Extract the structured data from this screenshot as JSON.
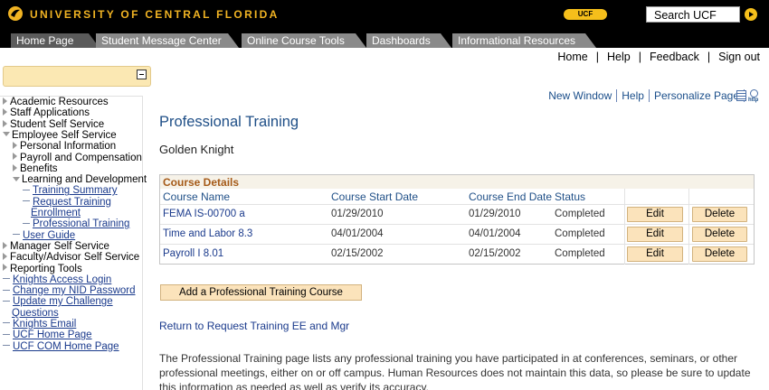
{
  "header": {
    "university_name": "UNIVERSITY OF CENTRAL FLORIDA",
    "badge": "UCF",
    "search_value": "Search UCF",
    "logo_icon": "pegasus-logo-icon",
    "search_go_icon": "go-arrow-icon",
    "brand_color": "#f0b323"
  },
  "nav": {
    "tabs": [
      {
        "label": "Home Page",
        "active": true
      },
      {
        "label": "Student Message Center",
        "active": false
      },
      {
        "label": "Online Course Tools",
        "active": false
      },
      {
        "label": "Dashboards",
        "active": false
      },
      {
        "label": "Informational Resources",
        "active": false
      }
    ]
  },
  "utility_links": [
    "Home",
    "Help",
    "Feedback",
    "Sign out"
  ],
  "page_links": {
    "new_window": "New Window",
    "help": "Help",
    "personalize": "Personalize Page",
    "http_icon_text": "http"
  },
  "sidebar": {
    "items": [
      {
        "label": "Academic Resources",
        "kind": "collapsed"
      },
      {
        "label": "Staff Applications",
        "kind": "collapsed"
      },
      {
        "label": "Student Self Service",
        "kind": "collapsed"
      },
      {
        "label": "Employee Self Service",
        "kind": "expanded"
      },
      {
        "label": "Personal Information",
        "kind": "collapsed"
      },
      {
        "label": "Payroll and Compensation",
        "kind": "collapsed"
      },
      {
        "label": "Benefits",
        "kind": "collapsed"
      },
      {
        "label": "Learning and Development",
        "kind": "expanded"
      },
      {
        "label": "Training Summary",
        "kind": "link"
      },
      {
        "label": "Request Training",
        "kind": "link"
      },
      {
        "label": "Enrollment",
        "kind": "link-cont"
      },
      {
        "label": "Professional Training",
        "kind": "link"
      },
      {
        "label": "User Guide",
        "kind": "link"
      },
      {
        "label": "Manager Self Service",
        "kind": "collapsed"
      },
      {
        "label": "Faculty/Advisor Self Service",
        "kind": "collapsed"
      },
      {
        "label": "Reporting Tools",
        "kind": "collapsed"
      },
      {
        "label": "Knights Access Login",
        "kind": "link"
      },
      {
        "label": "Change my NID Password",
        "kind": "link"
      },
      {
        "label": "Update my Challenge",
        "kind": "link"
      },
      {
        "label": "Questions",
        "kind": "link-cont"
      },
      {
        "label": "Knights Email",
        "kind": "link"
      },
      {
        "label": "UCF Home Page",
        "kind": "link"
      },
      {
        "label": "UCF COM Home Page",
        "kind": "link"
      }
    ]
  },
  "main": {
    "title": "Professional Training",
    "person_name": "Golden Knight",
    "grid": {
      "title": "Course Details",
      "columns": [
        "Course Name",
        "Course Start Date",
        "Course End Date",
        "Status"
      ],
      "rows": [
        {
          "name": "FEMA IS-00700 a",
          "start": "01/29/2010",
          "end": "01/29/2010",
          "status": "Completed"
        },
        {
          "name": "Time and Labor 8.3",
          "start": "04/01/2004",
          "end": "04/01/2004",
          "status": "Completed"
        },
        {
          "name": "Payroll I 8.01",
          "start": "02/15/2002",
          "end": "02/15/2002",
          "status": "Completed"
        }
      ],
      "edit_label": "Edit",
      "delete_label": "Delete"
    },
    "add_button": "Add a Professional Training Course",
    "return_link": "Return to Request Training EE and Mgr",
    "description": "The Professional Training page lists any professional training you have participated in at conferences, seminars, or other professional meetings, either on or off campus. Human Resources does not maintain this data, so please be sure to update this information as needed as well as verify its accuracy."
  }
}
